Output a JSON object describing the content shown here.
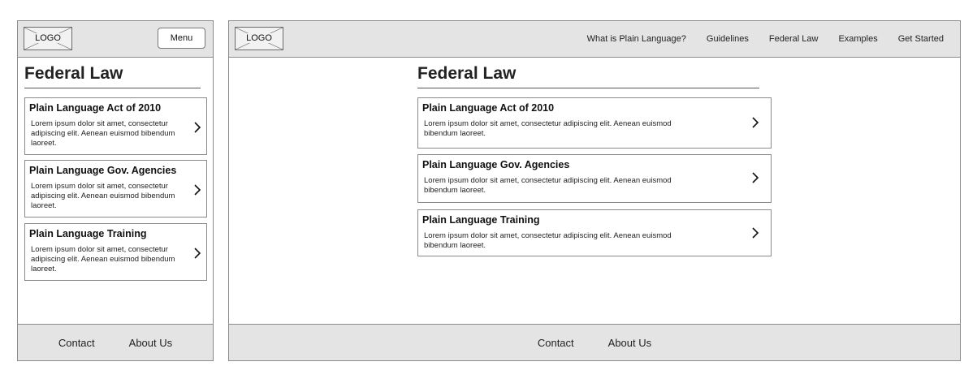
{
  "logo": {
    "label": "LOGO"
  },
  "mobile": {
    "menu_label": "Menu",
    "page_title": "Federal Law",
    "cards": [
      {
        "title": "Plain Language Act of 2010",
        "desc": "Lorem ipsum dolor sit amet, consectetur adipiscing elit. Aenean euismod bibendum laoreet."
      },
      {
        "title": "Plain Language Gov. Agencies",
        "desc": "Lorem ipsum dolor sit amet, consectetur adipiscing elit. Aenean euismod bibendum laoreet."
      },
      {
        "title": "Plain Language Training",
        "desc": "Lorem ipsum dolor sit amet, consectetur adipiscing elit. Aenean euismod bibendum laoreet."
      }
    ],
    "footer": {
      "contact": "Contact",
      "about": "About Us"
    }
  },
  "desktop": {
    "nav": [
      "What is Plain Language?",
      "Guidelines",
      "Federal Law",
      "Examples",
      "Get Started"
    ],
    "page_title": "Federal Law",
    "cards": [
      {
        "title": "Plain Language Act of 2010",
        "desc": "Lorem ipsum dolor sit amet, consectetur adipiscing elit. Aenean euismod bibendum laoreet."
      },
      {
        "title": "Plain Language Gov. Agencies",
        "desc": "Lorem ipsum dolor sit amet, consectetur adipiscing elit. Aenean euismod bibendum laoreet."
      },
      {
        "title": "Plain Language Training",
        "desc": "Lorem ipsum dolor sit amet, consectetur adipiscing elit. Aenean euismod bibendum laoreet."
      }
    ],
    "footer": {
      "contact": "Contact",
      "about": "About Us"
    }
  }
}
